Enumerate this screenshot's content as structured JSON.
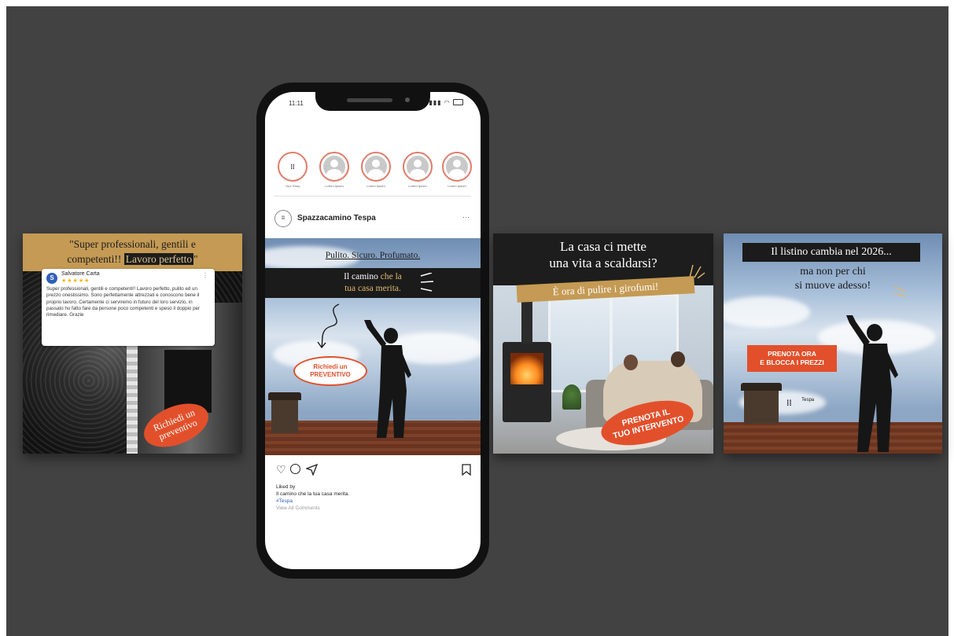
{
  "card1": {
    "quote_line1": "\"Super professionali, gentili e",
    "quote_line2": "competenti!! ",
    "quote_highlight": "Lavoro perfetto",
    "quote_end": "\"",
    "reviewer_initial": "S",
    "reviewer_name": "Salvatore Carta",
    "stars": "★★★★★",
    "review_text": "Super professionali, gentili e competenti!! Lavoro perfetto, pulito ed un prezzo onestissimo. Sono perfettamente attrezzati e conoscono bene il proprio lavoro. Certamente ci serviremo in futuro del loro servizio, in passato ho fatto fare da persone poco competenti e speso il doppio per rimediare. Grazie",
    "cta_line1": "Richiedi un",
    "cta_line2": "preventivo",
    "colors": {
      "band": "#c49a54",
      "cta": "#e2502b"
    }
  },
  "phone": {
    "time": "11:11",
    "stories": [
      {
        "label": "Your Story",
        "logo": true
      },
      {
        "label": "Lorem Ipsum",
        "logo": false
      },
      {
        "label": "Lorem Ipsum",
        "logo": false
      },
      {
        "label": "Lorem Ipsum",
        "logo": false
      },
      {
        "label": "Lorem Ipsum",
        "logo": false
      }
    ],
    "logo_glyph": "⁞⁞",
    "account_name": "Spazzacamino Tespa",
    "more": "···",
    "post": {
      "tagline": "Pulito. Sicuro. Profumato.",
      "headline_white1": "Il camino ",
      "headline_gold": "che la",
      "headline_line2": "tua casa merita.",
      "cta_line1": "Richiedi un",
      "cta_line2": "PREVENTIVO"
    },
    "liked_by": "Liked by",
    "caption": "Il camino che la tua casa merita.",
    "hashtag": "#Tespa",
    "view_all": "View All Comments"
  },
  "card3": {
    "headline_line1": "La casa ci mette",
    "headline_line2": "una vita a scaldarsi?",
    "sub": "È ora di pulire i girofumi!",
    "cta_line1": "PRENOTA IL",
    "cta_line2": "TUO INTERVENTO",
    "colors": {
      "band": "#c49a54",
      "cta": "#e2502b"
    }
  },
  "card4": {
    "headline_line1": "Il listino cambia nel 2026...",
    "headline_line2": "ma non per chi",
    "headline_line3": "si muove adesso!",
    "cta_line1": "PRENOTA ORA",
    "cta_line2": "E BLOCCA I PREZZI",
    "sign_text": "Tespa",
    "colors": {
      "cta": "#e2502b"
    }
  }
}
